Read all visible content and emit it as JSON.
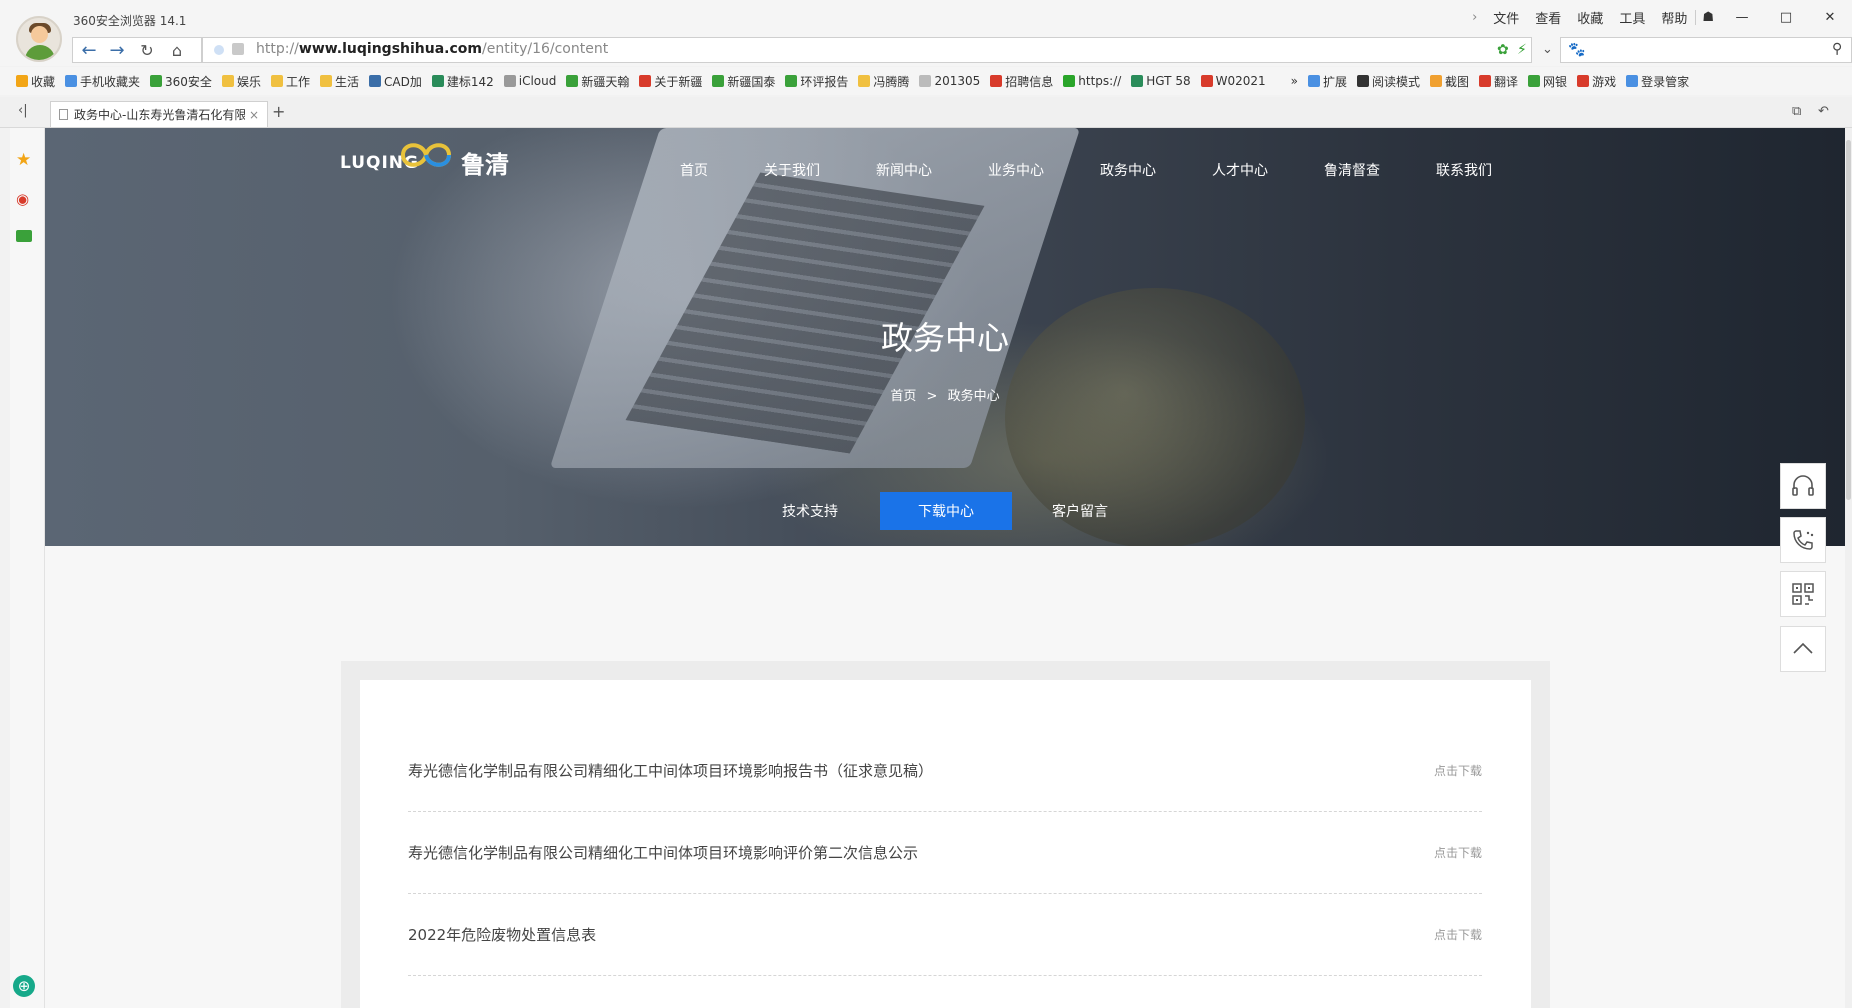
{
  "browser": {
    "app_title": "360安全浏览器 14.1",
    "menu": [
      "文件",
      "查看",
      "收藏",
      "工具",
      "帮助"
    ],
    "window_controls": [
      "—",
      "□",
      "✕"
    ],
    "url_prefix": "http://",
    "url_domain": "www.luqingshihua.com",
    "url_path": "/entity/16/content",
    "search_icon": "search-icon",
    "bookmarks": [
      {
        "label": "收藏",
        "color": "#f2a516"
      },
      {
        "label": "手机收藏夹",
        "color": "#4a90e2"
      },
      {
        "label": "360安全",
        "color": "#3aa13a"
      },
      {
        "label": "娱乐",
        "color": "#f0c040"
      },
      {
        "label": "工作",
        "color": "#f0c040"
      },
      {
        "label": "生活",
        "color": "#f0c040"
      },
      {
        "label": "CAD加",
        "color": "#3b6ea8"
      },
      {
        "label": "建标142",
        "color": "#2a8c5a"
      },
      {
        "label": "iCloud",
        "color": "#999999"
      },
      {
        "label": "新疆天翰",
        "color": "#3aa13a"
      },
      {
        "label": "关于新疆",
        "color": "#d83b2b"
      },
      {
        "label": "新疆国泰",
        "color": "#3aa13a"
      },
      {
        "label": "环评报告",
        "color": "#3aa13a"
      },
      {
        "label": "冯腾腾",
        "color": "#f0c040"
      },
      {
        "label": "201305",
        "color": "#bbbbbb"
      },
      {
        "label": "招聘信息",
        "color": "#d83b2b"
      },
      {
        "label": "https://",
        "color": "#2aa52a"
      },
      {
        "label": "HGT 58",
        "color": "#2a8c5a"
      },
      {
        "label": "W02021",
        "color": "#d83b2b"
      },
      {
        "label": "»",
        "color": "#f5f5f5"
      },
      {
        "label": "扩展",
        "color": "#4a90e2"
      },
      {
        "label": "阅读模式",
        "color": "#333333"
      },
      {
        "label": "截图",
        "color": "#f0a030"
      },
      {
        "label": "翻译",
        "color": "#d83b2b"
      },
      {
        "label": "网银",
        "color": "#3aa13a"
      },
      {
        "label": "游戏",
        "color": "#d83b2b"
      },
      {
        "label": "登录管家",
        "color": "#4a90e2"
      }
    ],
    "tab_title": "政务中心-山东寿光鲁清石化有限",
    "tab_close": "×",
    "new_tab": "+"
  },
  "site": {
    "logo_en": "LUQING",
    "logo_cn": "鲁清",
    "nav": [
      "首页",
      "关于我们",
      "新闻中心",
      "业务中心",
      "政务中心",
      "人才中心",
      "鲁清督查",
      "联系我们"
    ],
    "hero_title": "政务中心",
    "breadcrumb": {
      "home": "首页",
      "sep": ">",
      "current": "政务中心"
    },
    "subtabs": [
      "技术支持",
      "下载中心",
      "客户留言"
    ],
    "active_subtab": "下载中心",
    "accent": "#1a73e8",
    "downloads": [
      {
        "title": "寿光德信化学制品有限公司精细化工中间体项目环境影响报告书（征求意见稿）",
        "action": "点击下载"
      },
      {
        "title": "寿光德信化学制品有限公司精细化工中间体项目环境影响评价第二次信息公示",
        "action": "点击下载"
      },
      {
        "title": "2022年危险废物处置信息表",
        "action": "点击下载"
      }
    ],
    "right_tools": [
      "headset-icon",
      "phone-icon",
      "qrcode-icon",
      "back-to-top-icon"
    ]
  }
}
